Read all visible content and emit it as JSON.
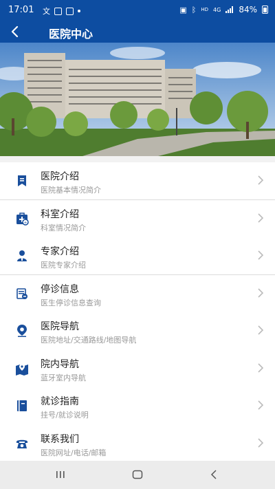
{
  "status_bar": {
    "time": "17:01",
    "network": "4G",
    "battery": "84%"
  },
  "header": {
    "title": "医院中心"
  },
  "menu": [
    {
      "title": "医院介绍",
      "subtitle": "医院基本情况简介",
      "icon": "bookmark-icon"
    },
    {
      "title": "科室介绍",
      "subtitle": "科室情况简介",
      "icon": "medical-kit-icon"
    },
    {
      "title": "专家介绍",
      "subtitle": "医院专家介绍",
      "icon": "doctor-icon"
    },
    {
      "title": "停诊信息",
      "subtitle": "医生停诊信息查询",
      "icon": "calendar-icon"
    },
    {
      "title": "医院导航",
      "subtitle": "医院地址/交通路线/地图导航",
      "icon": "location-pin-icon"
    },
    {
      "title": "院内导航",
      "subtitle": "蓝牙室内导航",
      "icon": "indoor-map-icon"
    },
    {
      "title": "就诊指南",
      "subtitle": "挂号/就诊说明",
      "icon": "guide-book-icon"
    },
    {
      "title": "联系我们",
      "subtitle": "医院网址/电话/邮箱",
      "icon": "telephone-icon"
    }
  ],
  "colors": {
    "primary": "#0d4da1",
    "icon": "#1a4f9c"
  }
}
